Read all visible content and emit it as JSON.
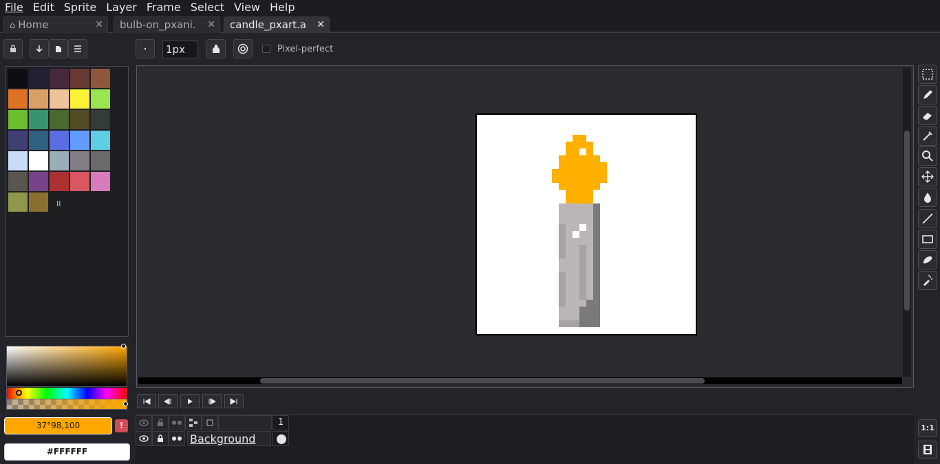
{
  "menu": [
    "File",
    "Edit",
    "Sprite",
    "Layer",
    "Frame",
    "Select",
    "View",
    "Help"
  ],
  "tabs": [
    {
      "label": "Home"
    },
    {
      "label": "bulb-on_pxani."
    },
    {
      "label": "candle_pxart.a"
    }
  ],
  "tool_options": {
    "brush_size": "1px",
    "pixel_perfect_label": "Pixel-perfect",
    "pixel_perfect_checked": false
  },
  "palette": {
    "colors": [
      "#0e0e12",
      "#222034",
      "#45283c",
      "#663931",
      "#8f563b",
      "#df7126",
      "#d9a066",
      "#eec39a",
      "#fbf236",
      "#99e550",
      "#6abe30",
      "#37946e",
      "#4b692f",
      "#524b24",
      "#323c39",
      "#3f3f74",
      "#306082",
      "#5b6ee1",
      "#639bff",
      "#5fcde4",
      "#cbdbfc",
      "#ffffff",
      "#9badb7",
      "#847e87",
      "#696a6a",
      "#595652",
      "#76428a",
      "#ac3232",
      "#d95763",
      "#d77bba",
      "#8f974a",
      "#8a6f30"
    ],
    "handle_glyph": "II"
  },
  "colors": {
    "foreground_label": "37°98,100",
    "foreground_hex": "#ffa600",
    "background_label": "#FFFFFF",
    "background_hex": "#ffffff",
    "warning_glyph": "!"
  },
  "timeline": {
    "frame_number": "1",
    "layer_name": "Background"
  },
  "zoom_label": "1:1",
  "icons": {
    "tab_home": "home-icon",
    "tab_close": "close-icon",
    "lock": "lock-icon",
    "eye": "eye-icon",
    "link": "link-icon"
  }
}
